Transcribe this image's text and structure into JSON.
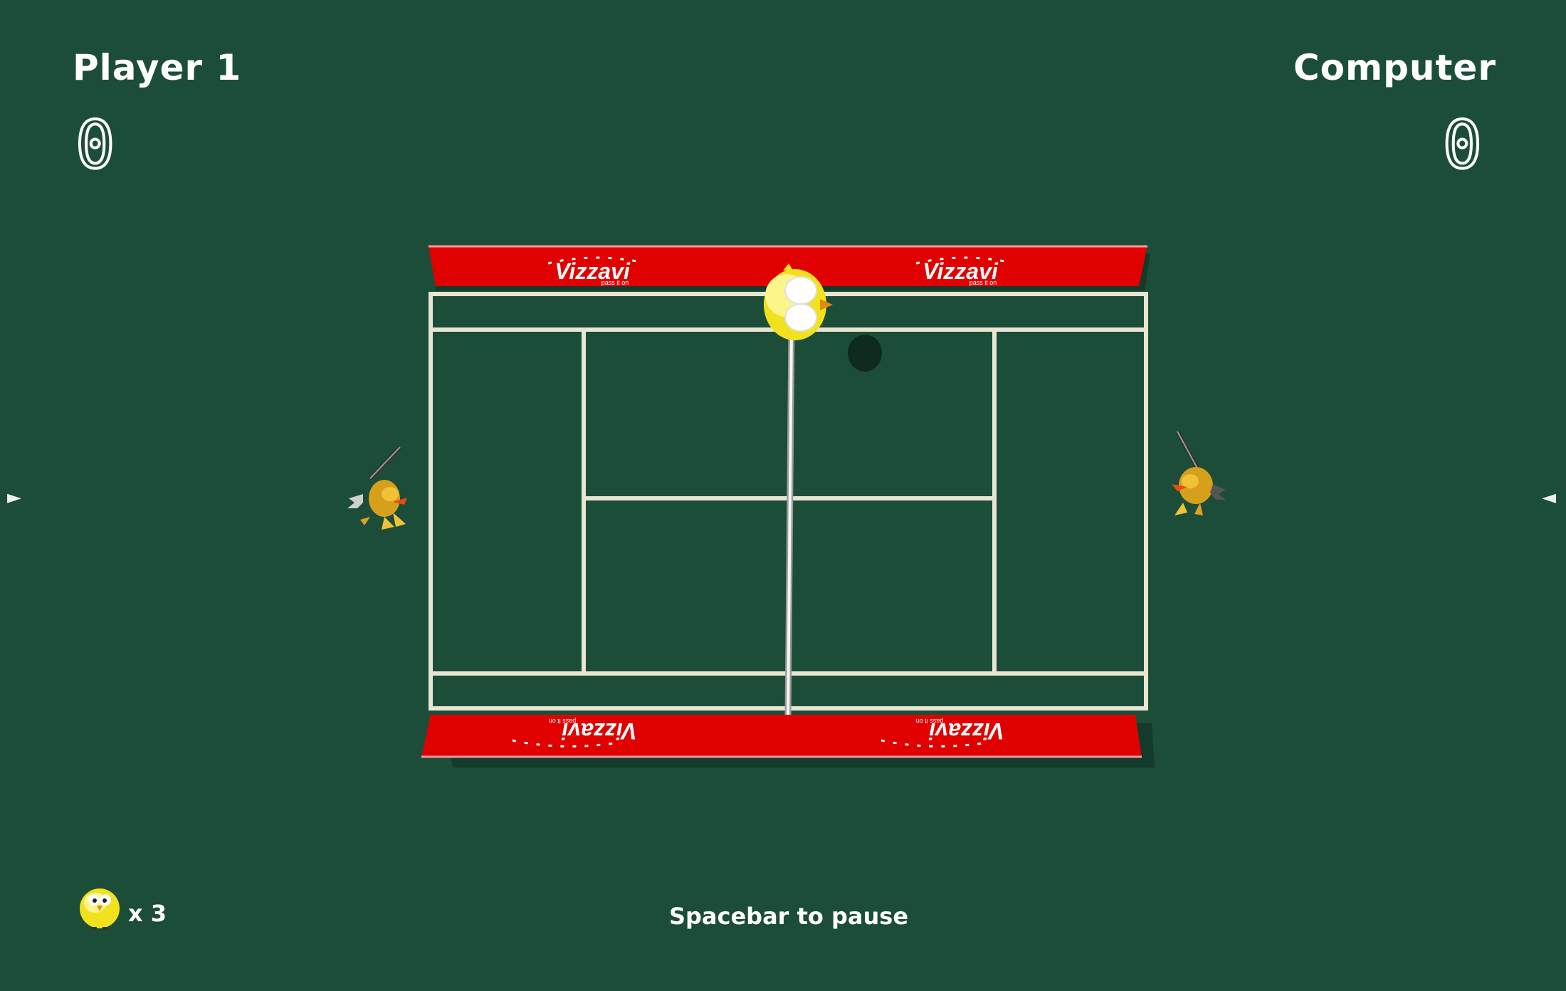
{
  "players": {
    "left": {
      "name": "Player 1",
      "score": "0"
    },
    "right": {
      "name": "Computer",
      "score": "0"
    }
  },
  "banners": {
    "text": "Vizzavi",
    "tagline": "pass it on"
  },
  "lives": {
    "count_label": "x 3"
  },
  "hint": "Spacebar to pause",
  "icons": {
    "left_arrow": "triangle-right",
    "right_arrow": "triangle-left",
    "life": "chick-icon"
  },
  "colors": {
    "background": "#1b4d39",
    "court_lines": "#e8e6d2",
    "banner": "#e10000",
    "text": "#ffffff",
    "chick": "#f5e62a"
  }
}
